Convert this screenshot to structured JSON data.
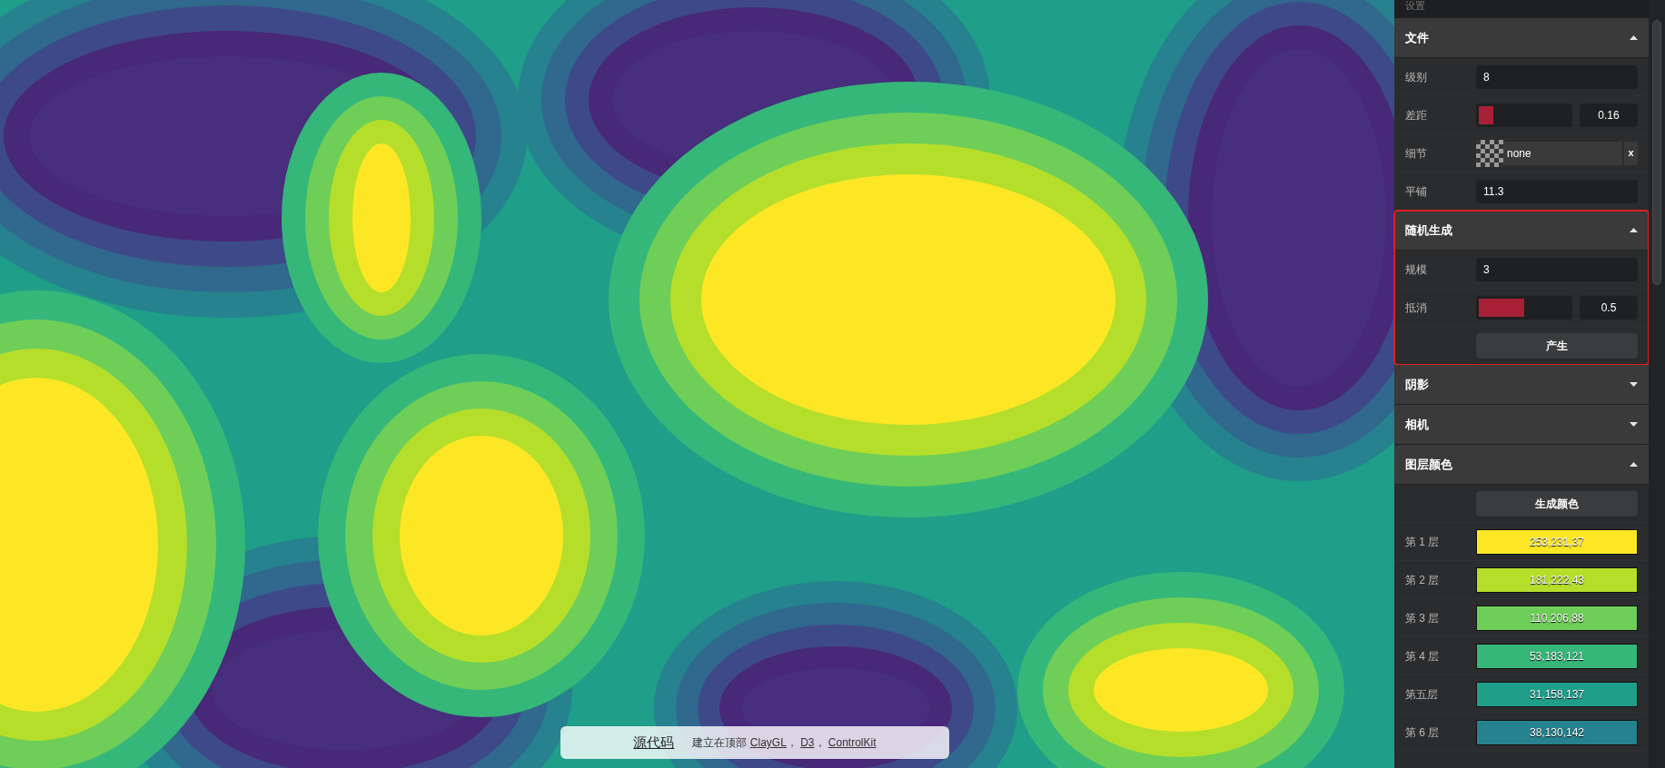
{
  "panel": {
    "title": "设置",
    "sections": [
      {
        "title": "文件",
        "expanded": true,
        "rows": [
          {
            "kind": "text",
            "label": "级别",
            "value": "8"
          },
          {
            "kind": "slider",
            "label": "差距",
            "level": 0.16,
            "reading": "0.16"
          },
          {
            "kind": "image",
            "label": "细节",
            "value": "none",
            "clear": "x"
          },
          {
            "kind": "text",
            "label": "平铺",
            "value": "11.3"
          }
        ]
      },
      {
        "title": "随机生成",
        "expanded": true,
        "highlighted": true,
        "rows": [
          {
            "kind": "text",
            "label": "规模",
            "value": "3"
          },
          {
            "kind": "slider",
            "label": "抵消",
            "level": 0.5,
            "reading": "0.5"
          },
          {
            "kind": "button",
            "text": "产生"
          }
        ]
      },
      {
        "title": "阴影",
        "expanded": false
      },
      {
        "title": "相机",
        "expanded": false
      },
      {
        "title": "图层颜色",
        "expanded": true,
        "rows": [
          {
            "kind": "button",
            "text": "生成颜色"
          },
          {
            "kind": "color",
            "label": "第 1 层",
            "value": "253,231,37",
            "color": "#fde725"
          },
          {
            "kind": "color",
            "label": "第 2 层",
            "value": "181,222,43",
            "color": "#b5de2b"
          },
          {
            "kind": "color",
            "label": "第 3 层",
            "value": "110,206,88",
            "color": "#6ece58"
          },
          {
            "kind": "color",
            "label": "第 4 层",
            "value": "53,183,121",
            "color": "#35b779"
          },
          {
            "kind": "color",
            "label": "第五层",
            "value": "31,158,137",
            "color": "#1f9e89"
          },
          {
            "kind": "color",
            "label": "第 6 层",
            "value": "38,130,142",
            "color": "#26828e"
          }
        ]
      }
    ]
  },
  "footer": {
    "source_link": "源代码",
    "text": "建立在顶部",
    "links": [
      "ClayGL",
      "D3",
      "ControlKit"
    ],
    "separator": "，"
  }
}
